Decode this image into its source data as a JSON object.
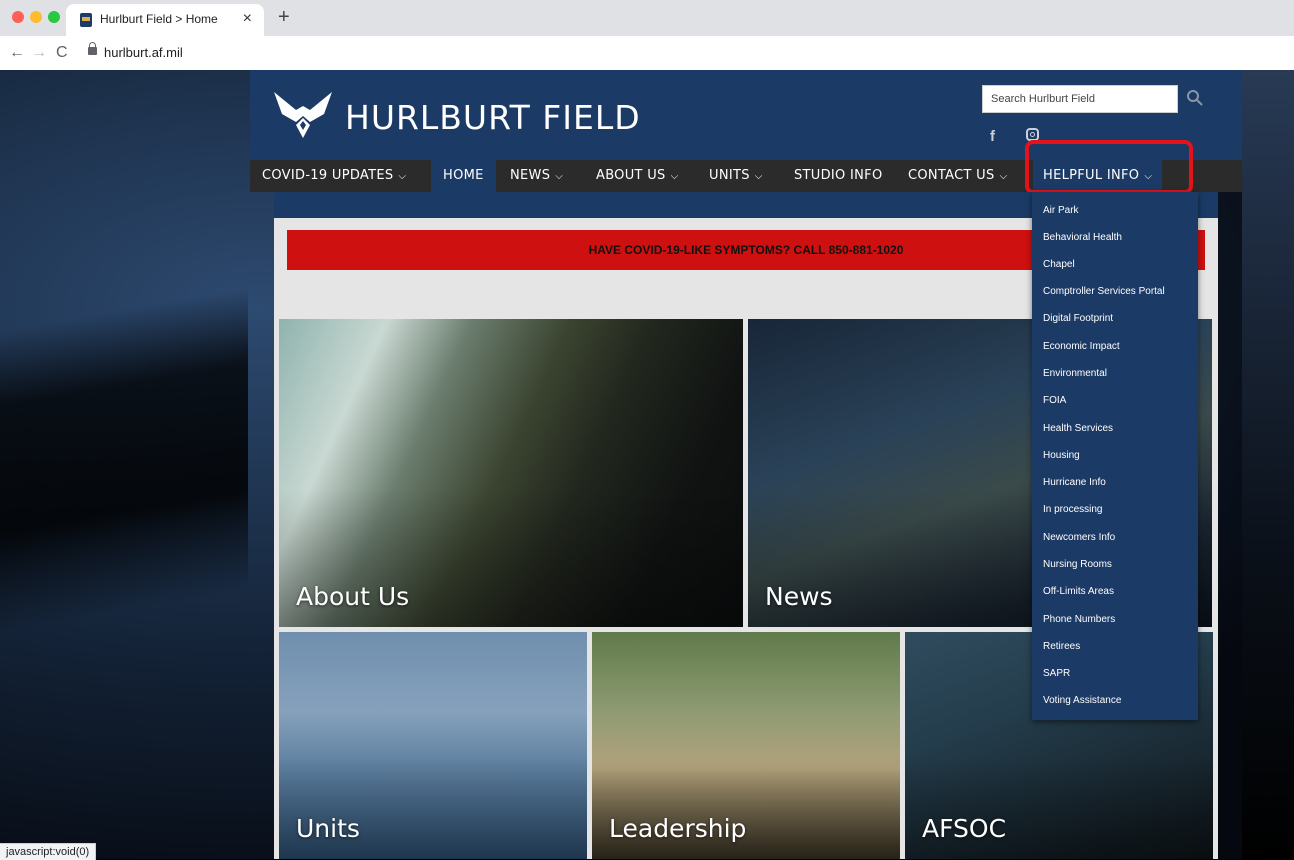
{
  "browser": {
    "tab_title": "Hurlburt Field > Home",
    "tab_close": "×",
    "new_tab": "+",
    "back": "←",
    "forward": "→",
    "reload": "C",
    "url": "hurlburt.af.mil",
    "status_text": "javascript:void(0)"
  },
  "site": {
    "title": "HURLBURT FIELD",
    "search_placeholder": "Search Hurlburt Field",
    "facebook": "f"
  },
  "nav": {
    "items": [
      {
        "label": "COVID-19 UPDATES",
        "dropdown": true
      },
      {
        "label": "HOME",
        "dropdown": false,
        "active": true
      },
      {
        "label": "NEWS",
        "dropdown": true
      },
      {
        "label": "ABOUT US",
        "dropdown": true
      },
      {
        "label": "UNITS",
        "dropdown": true
      },
      {
        "label": "STUDIO INFO",
        "dropdown": false
      },
      {
        "label": "CONTACT US",
        "dropdown": true
      },
      {
        "label": "HELPFUL INFO",
        "dropdown": true,
        "open": true
      }
    ],
    "chevron": "⌵"
  },
  "alert": {
    "text": "HAVE COVID-19-LIKE SYMPTOMS?  CALL 850-881-1020"
  },
  "tiles": {
    "about": "About Us",
    "news": "News",
    "units": "Units",
    "leadership": "Leadership",
    "afsoc": "AFSOC"
  },
  "dropdown": {
    "items": [
      "Air Park",
      "Behavioral Health",
      "Chapel",
      "Comptroller Services Portal",
      "Digital Footprint",
      "Economic Impact",
      "Environmental",
      "FOIA",
      "Health Services",
      "Housing",
      "Hurricane Info",
      "In processing",
      "Newcomers Info",
      "Nursing Rooms",
      "Off-Limits Areas",
      "Phone Numbers",
      "Retirees",
      "SAPR",
      "Voting Assistance"
    ]
  },
  "colors": {
    "brand_blue": "#1b3a65",
    "nav_dark": "#2b2b2b",
    "alert_red": "#cf1010",
    "highlight_red": "#e3131b"
  }
}
